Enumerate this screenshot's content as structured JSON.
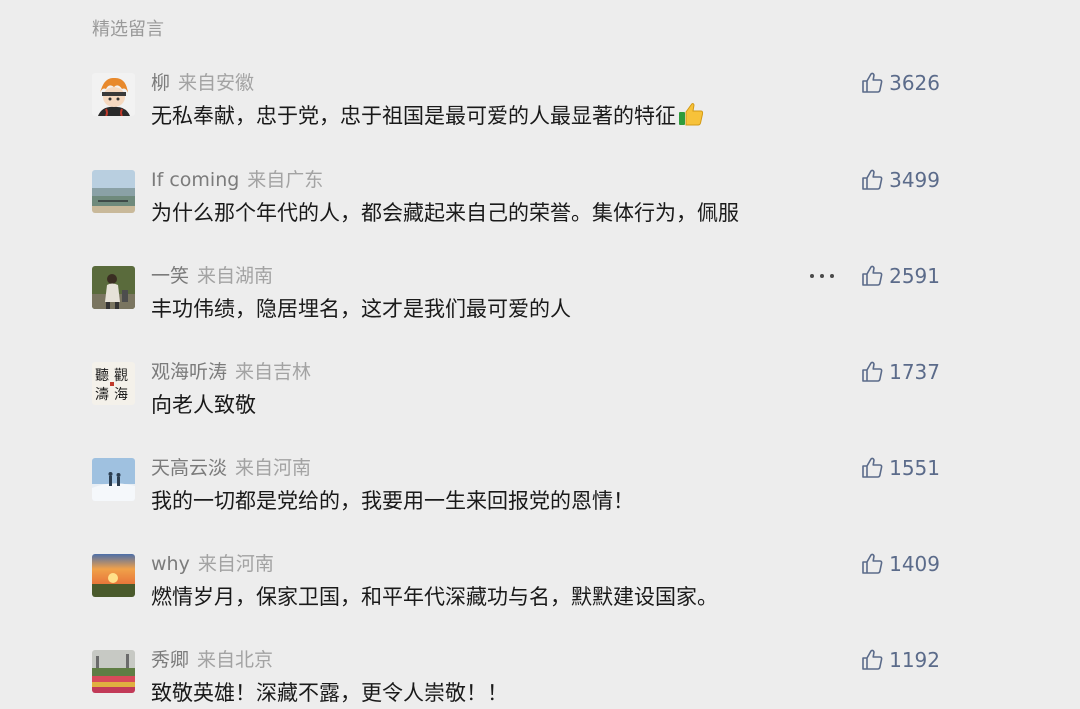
{
  "section_title": "精选留言",
  "comments": [
    {
      "name": "柳",
      "location": "来自安徽",
      "text": "无私奉献，忠于党，忠于祖国是最可爱的人最显著的特征",
      "likes": "3626",
      "avatar": "avatar-cartoon-icon",
      "emoji": "thumbs-up-emoji"
    },
    {
      "name": "If coming",
      "location": "来自广东",
      "text": "为什么那个年代的人，都会藏起来自己的荣誉。集体行为，佩服",
      "likes": "3499",
      "avatar": "avatar-landscape-icon"
    },
    {
      "name": "一笑",
      "location": "来自湖南",
      "text": "丰功伟绩，隐居埋名，这才是我们最可爱的人",
      "likes": "2591",
      "avatar": "avatar-person-icon",
      "has_more": true
    },
    {
      "name": "观海听涛",
      "location": "来自吉林",
      "text": "向老人致敬",
      "likes": "1737",
      "avatar": "avatar-calligraphy-icon",
      "avatar_text": "观海听涛"
    },
    {
      "name": "天高云淡",
      "location": "来自河南",
      "text": "我的一切都是党给的，我要用一生来回报党的恩情！",
      "likes": "1551",
      "avatar": "avatar-snow-icon"
    },
    {
      "name": "why",
      "location": "来自河南",
      "text": "燃情岁月，保家卫国，和平年代深藏功与名，默默建设国家。",
      "likes": "1409",
      "avatar": "avatar-sunset-icon"
    },
    {
      "name": "秀卿",
      "location": "来自北京",
      "text": "致敬英雄！深藏不露，更令人崇敬！！",
      "likes": "1192",
      "avatar": "avatar-garden-icon"
    }
  ],
  "colors": {
    "background": "#ededed",
    "like_color": "#5b6b8a",
    "text": "#1a1a1a",
    "meta": "#7b7b7b"
  }
}
